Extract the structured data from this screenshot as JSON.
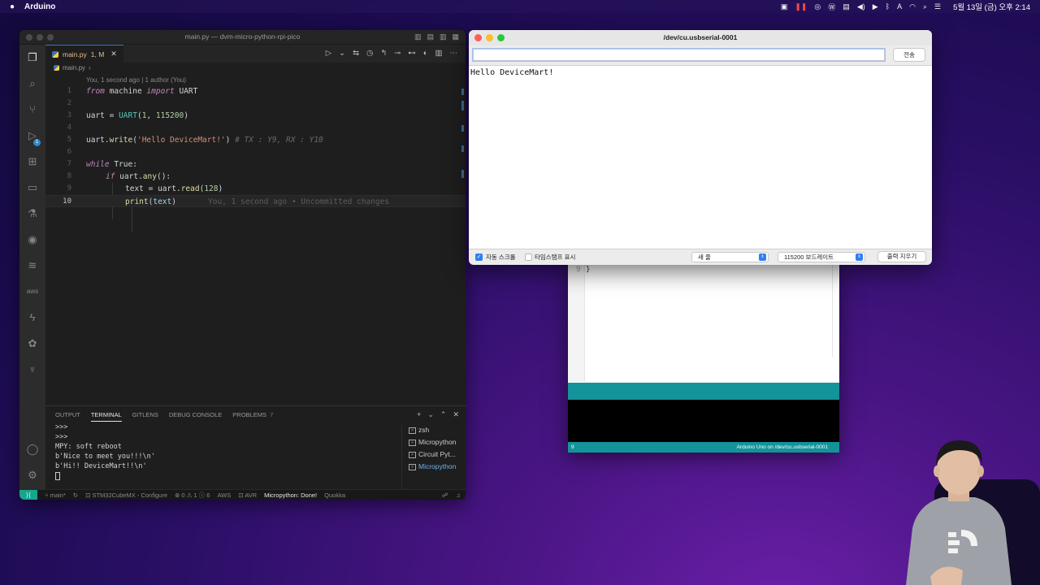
{
  "menubar": {
    "app_name": "Arduino",
    "clock": "5월 13일 (금) 오후 2:14"
  },
  "vscode": {
    "window_title": "main.py — dvm-micro-python-rpi-pico",
    "tab": {
      "label": "main.py",
      "status": "1, M"
    },
    "breadcrumb": "main.py",
    "blame": "You, 1 second ago | 1 author (You)",
    "lines": [
      {
        "n": "1"
      },
      {
        "n": "2"
      },
      {
        "n": "3"
      },
      {
        "n": "4"
      },
      {
        "n": "5"
      },
      {
        "n": "6"
      },
      {
        "n": "7"
      },
      {
        "n": "8"
      },
      {
        "n": "9"
      },
      {
        "n": "10"
      }
    ],
    "code": {
      "l1_from": "from",
      "l1_mod": "machine",
      "l1_import": "import",
      "l1_cls": "UART",
      "l3_var": "uart",
      "l3_eq": " = ",
      "l3_cls": "UART",
      "l3_open": "(",
      "l3_a": "1",
      "l3_sep": ", ",
      "l3_b": "115200",
      "l3_close": ")",
      "l5_var": "uart",
      "l5_dot": ".",
      "l5_fn": "write",
      "l5_open": "(",
      "l5_str": "'Hello DeviceMart!'",
      "l5_close": ")",
      "l5_cmt": " # TX : Y9, RX : Y10",
      "l7_kw": "while",
      "l7_rest": " True:",
      "l8_kw": "if",
      "l8_var": " uart",
      "l8_dot": ".",
      "l8_fn": "any",
      "l8_rest": "():",
      "l9_var": "text",
      "l9_eq": " = ",
      "l9_var2": "uart",
      "l9_dot": ".",
      "l9_fn": "read",
      "l9_open": "(",
      "l9_num": "128",
      "l9_close": ")",
      "l10_fn": "print",
      "l10_open": "(",
      "l10_var": "text",
      "l10_close": ")",
      "l10_ghost": "You, 1 second ago • Uncommitted changes"
    },
    "panel": {
      "tabs": [
        {
          "label": "OUTPUT"
        },
        {
          "label": "TERMINAL"
        },
        {
          "label": "GITLENS"
        },
        {
          "label": "DEBUG CONSOLE"
        },
        {
          "label": "PROBLEMS"
        }
      ],
      "problems_count": "7",
      "terminal_lines": [
        ">>>",
        ">>>",
        "MPY: soft reboot",
        "b'Nice to meet you!!!\\n'",
        "b'Hi!! DeviceMart!!\\n'"
      ],
      "terminals": [
        {
          "label": "zsh"
        },
        {
          "label": "Micropython"
        },
        {
          "label": "Circuit Pyt..."
        },
        {
          "label": "Micropython"
        }
      ]
    },
    "statusbar": {
      "branch": "main*",
      "stm32": "STM32CubeMX - Configure",
      "problems": "⊗ 0 ⚠ 1 ⓘ 6",
      "aws": "AWS",
      "avr": "AVR",
      "micropython": "Micropython: Done!",
      "quokka": "Quokka"
    }
  },
  "arduino_ide": {
    "line_number": "9",
    "brace": "}",
    "status_line": "9",
    "status_board": "Arduino Uno on /dev/cu.usbserial-0001"
  },
  "serial_monitor": {
    "title": "/dev/cu.usbserial-0001",
    "send_label": "전송",
    "input_value": "",
    "output_text": "Hello DeviceMart!",
    "autoscroll_label": "자동 스크롤",
    "autoscroll_checked": true,
    "timestamp_label": "타임스탬프 표시",
    "timestamp_checked": false,
    "line_ending": "새 줄",
    "baud_rate": "115200 보드레이트",
    "clear_label": "출력 지우기"
  },
  "colors": {
    "accent_blue": "#2f7ff2",
    "arduino_teal": "#13939a",
    "remote_green": "#17a58c"
  }
}
